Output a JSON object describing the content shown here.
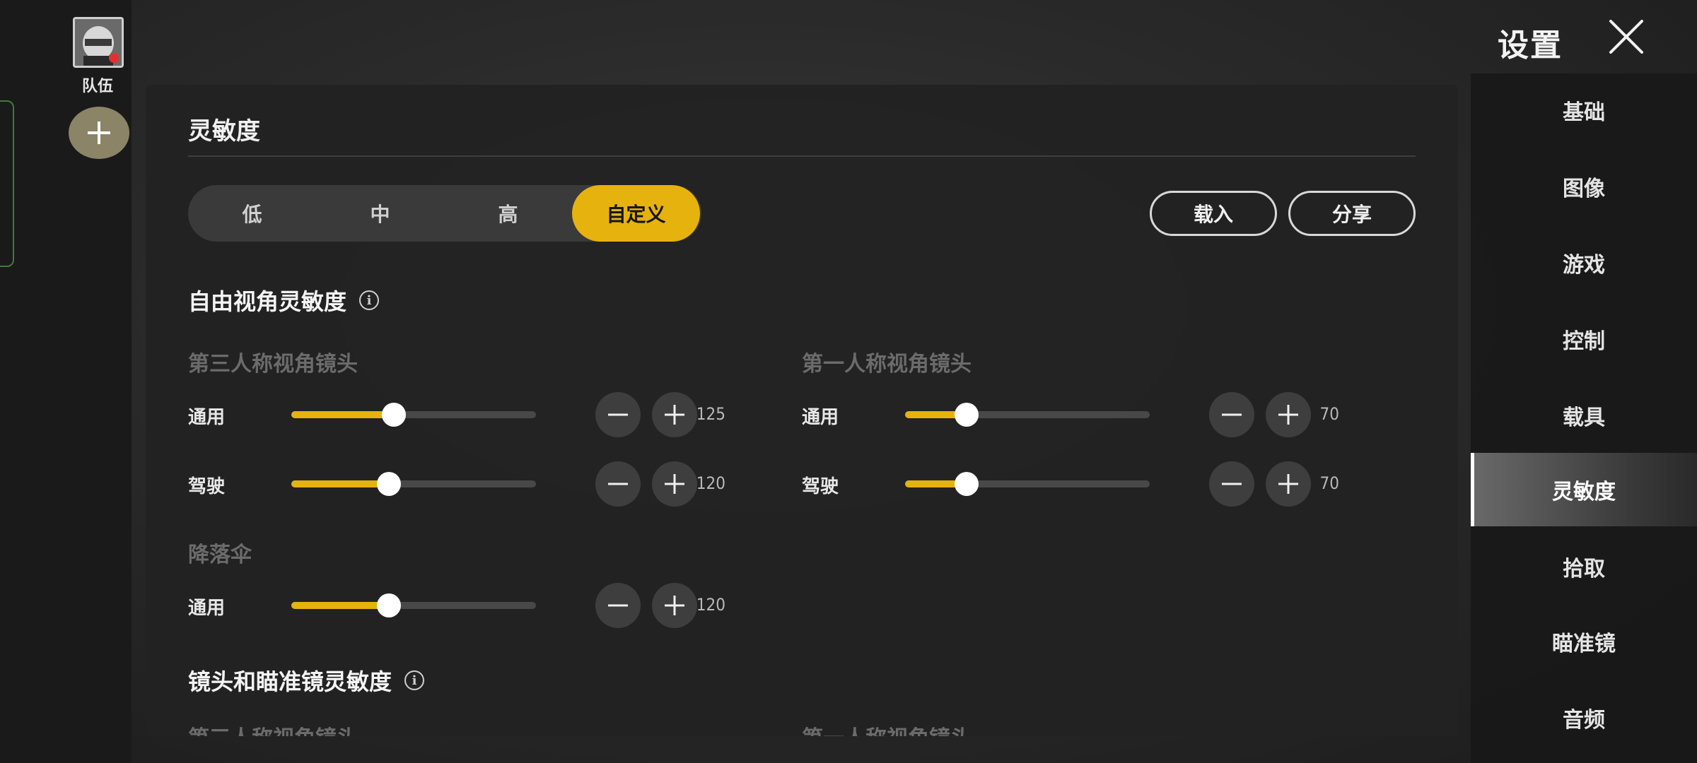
{
  "header": {
    "title": "设置"
  },
  "team": {
    "label": "队伍"
  },
  "panel": {
    "title": "灵敏度",
    "presets": [
      "低",
      "中",
      "高",
      "自定义"
    ],
    "active_preset": "自定义",
    "load_label": "载入",
    "share_label": "分享"
  },
  "free_look": {
    "title": "自由视角灵敏度",
    "third_person": {
      "title": "第三人称视角镜头",
      "general": {
        "label": "通用",
        "value": "125",
        "fraction": 0.42
      },
      "driving": {
        "label": "驾驶",
        "value": "120",
        "fraction": 0.4
      }
    },
    "first_person": {
      "title": "第一人称视角镜头",
      "general": {
        "label": "通用",
        "value": "70",
        "fraction": 0.25
      },
      "driving": {
        "label": "驾驶",
        "value": "70",
        "fraction": 0.25
      }
    },
    "parachute": {
      "title": "降落伞",
      "general": {
        "label": "通用",
        "value": "120",
        "fraction": 0.4
      }
    }
  },
  "camera_ads": {
    "title": "镜头和瞄准镜灵敏度",
    "third_person_title": "第三人称视角镜头",
    "first_person_title": "第一人称视角镜头"
  },
  "nav": {
    "items": [
      "基础",
      "图像",
      "游戏",
      "控制",
      "载具",
      "灵敏度",
      "拾取",
      "瞄准镜",
      "音频"
    ],
    "active": "灵敏度"
  },
  "colors": {
    "accent": "#e6b20e",
    "panel": "#222222",
    "text_dim": "#6b6b6b"
  }
}
